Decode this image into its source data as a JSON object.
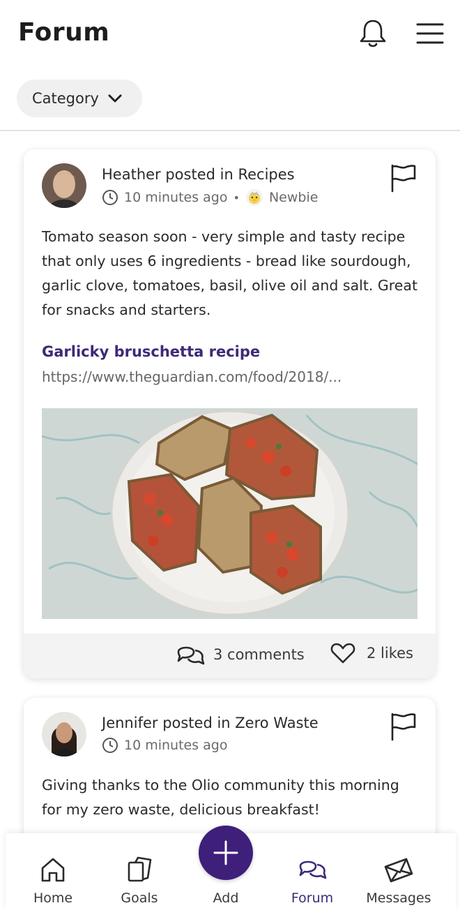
{
  "header": {
    "title": "Forum",
    "bell_icon": "bell-icon",
    "menu_icon": "hamburger-menu-icon"
  },
  "filter": {
    "category_label": "Category",
    "icon": "chevron-down-icon"
  },
  "posts": [
    {
      "author_line": "Heather posted in Recipes",
      "time": "10 minutes ago",
      "badge": "Newbie",
      "text": "Tomato season soon - very simple and tasty recipe that only uses 6 ingredients - bread like sourdough, garlic clove, tomatoes, basil, olive oil and salt. Great for snacks and starters.",
      "link_title": "Garlicky bruschetta recipe",
      "link_url": "https://www.theguardian.com/food/2018/...",
      "comments": "3 comments",
      "likes": "2 likes"
    },
    {
      "author_line": "Jennifer posted in Zero Waste",
      "time": "10 minutes ago",
      "text": "Giving thanks to the Olio community this morning for my zero waste, delicious breakfast!"
    }
  ],
  "nav": {
    "home": "Home",
    "goals": "Goals",
    "add": "Add",
    "forum": "Forum",
    "messages": "Messages"
  },
  "colors": {
    "accent": "#3e2a78",
    "add_button": "#3e1f7a",
    "chip_bg": "#f0f0f0",
    "footer_bg": "#f3f3f3"
  }
}
